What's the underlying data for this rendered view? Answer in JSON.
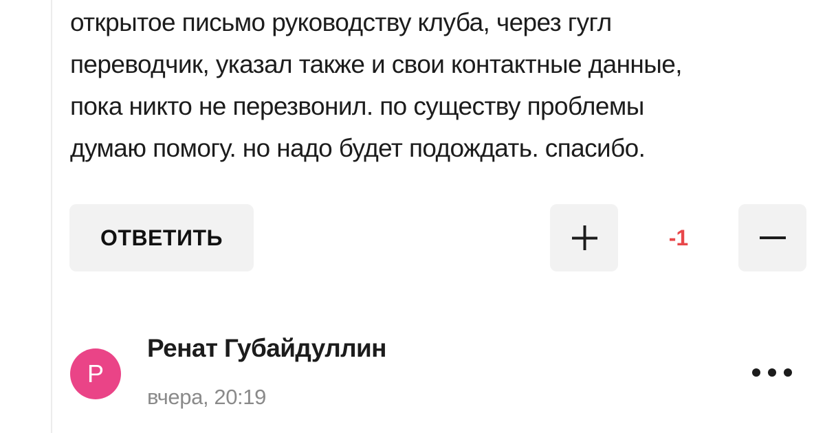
{
  "comment": {
    "text_lines": [
      "открытое письмо руководству клуба, через гугл",
      "переводчик, указал также и свои контактные данные,",
      "пока никто не перезвонил. по существу проблемы",
      "думаю помогу. но надо будет подождать. спасибо."
    ],
    "reply_label": "ОТВЕТИТЬ",
    "vote_score": "-1",
    "score_color": "#e8474a",
    "upvote_icon": "plus-icon",
    "downvote_icon": "minus-icon"
  },
  "next_comment": {
    "avatar_letter": "Р",
    "avatar_color": "#ea4487",
    "author": "Ренат Губайдуллин",
    "timestamp": "вчера, 20:19",
    "menu_icon": "more-horizontal-icon"
  }
}
